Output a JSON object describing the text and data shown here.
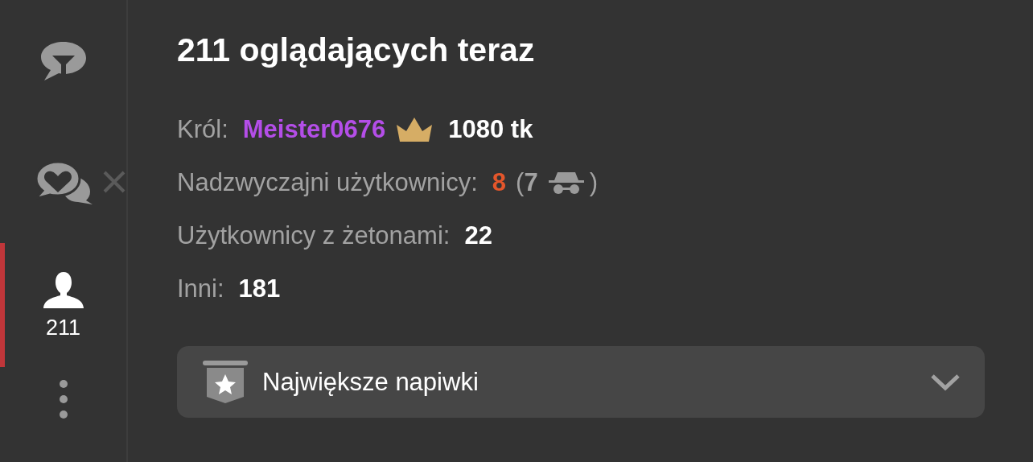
{
  "sidebar": {
    "items": [
      {
        "kind": "filter-chat",
        "selected": false
      },
      {
        "kind": "heart-chat",
        "selected": false,
        "closable": true
      },
      {
        "kind": "users",
        "selected": true,
        "count": "211"
      },
      {
        "kind": "more",
        "selected": false
      }
    ]
  },
  "title": "211 oglądających teraz",
  "stats": [
    {
      "kind": "king",
      "label": "Król:",
      "name": "Meister0676",
      "amount": "1080 tk"
    },
    {
      "kind": "split",
      "label": "Nadzwyczajni użytkownicy:",
      "value": "8",
      "color": "#e4562b",
      "open": "(",
      "hidden": "7",
      "close": ")"
    },
    {
      "kind": "plain",
      "label": "Użytkownicy z żetonami:",
      "value": "22",
      "color": "#ffffff"
    },
    {
      "kind": "plain",
      "label": "Inni:",
      "value": "181",
      "color": "#ffffff"
    }
  ],
  "dropdown": {
    "label": "Największe napiwki",
    "expanded": false
  }
}
